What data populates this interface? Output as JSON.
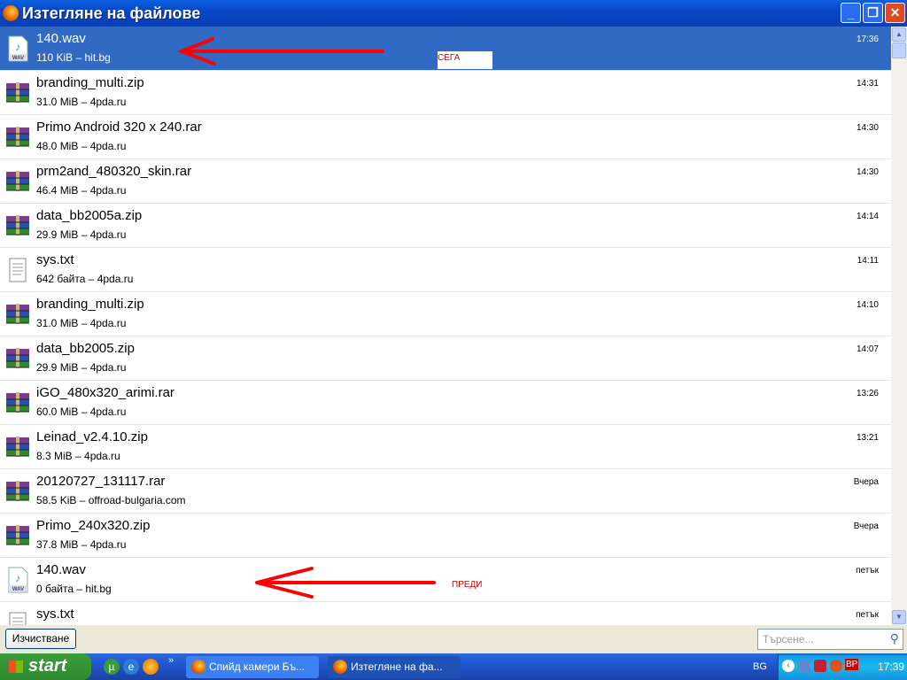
{
  "window": {
    "title": "Изтегляне на файлове",
    "buttons": [
      "minimize",
      "maximize",
      "close"
    ]
  },
  "downloads": [
    {
      "name": "140.wav",
      "meta": "110 KiB – hit.bg",
      "time": "17:36",
      "icon": "wav-icon",
      "selected": true
    },
    {
      "name": "branding_multi.zip",
      "meta": "31.0 MiB – 4pda.ru",
      "time": "14:31",
      "icon": "archive-icon"
    },
    {
      "name": "Primo Android 320 x 240.rar",
      "meta": "48.0 MiB – 4pda.ru",
      "time": "14:30",
      "icon": "archive-icon"
    },
    {
      "name": "prm2and_480320_skin.rar",
      "meta": "46.4 MiB – 4pda.ru",
      "time": "14:30",
      "icon": "archive-icon"
    },
    {
      "name": "data_bb2005a.zip",
      "meta": "29.9 MiB – 4pda.ru",
      "time": "14:14",
      "icon": "archive-icon"
    },
    {
      "name": "sys.txt",
      "meta": "642 байта – 4pda.ru",
      "time": "14:11",
      "icon": "text-icon"
    },
    {
      "name": "branding_multi.zip",
      "meta": "31.0 MiB – 4pda.ru",
      "time": "14:10",
      "icon": "archive-icon"
    },
    {
      "name": "data_bb2005.zip",
      "meta": "29.9 MiB – 4pda.ru",
      "time": "14:07",
      "icon": "archive-icon"
    },
    {
      "name": "iGO_480x320_arimi.rar",
      "meta": "60.0 MiB – 4pda.ru",
      "time": "13:26",
      "icon": "archive-icon"
    },
    {
      "name": "Leinad_v2.4.10.zip",
      "meta": "8.3 MiB – 4pda.ru",
      "time": "13:21",
      "icon": "archive-icon"
    },
    {
      "name": "20120727_131117.rar",
      "meta": "58.5 KiB – offroad-bulgaria.com",
      "time": "Вчера",
      "icon": "archive-icon"
    },
    {
      "name": "Primo_240x320.zip",
      "meta": "37.8 MiB – 4pda.ru",
      "time": "Вчера",
      "icon": "archive-icon"
    },
    {
      "name": "140.wav",
      "meta": "0 байта – hit.bg",
      "time": "петък",
      "icon": "wav-icon"
    },
    {
      "name": "sys.txt",
      "meta": "",
      "time": "петък",
      "icon": "text-icon"
    }
  ],
  "annotations": {
    "now": "СЕГА",
    "before": "ПРЕДИ"
  },
  "bottom": {
    "clear_label": "Изчистване",
    "search_placeholder": "Търсене..."
  },
  "taskbar": {
    "start_label": "start",
    "tasks": [
      "Спийд камери Бъ...",
      "Изтегляне на фа..."
    ],
    "lang": "BG",
    "clock": "17:39",
    "tray_badge": "BP"
  }
}
